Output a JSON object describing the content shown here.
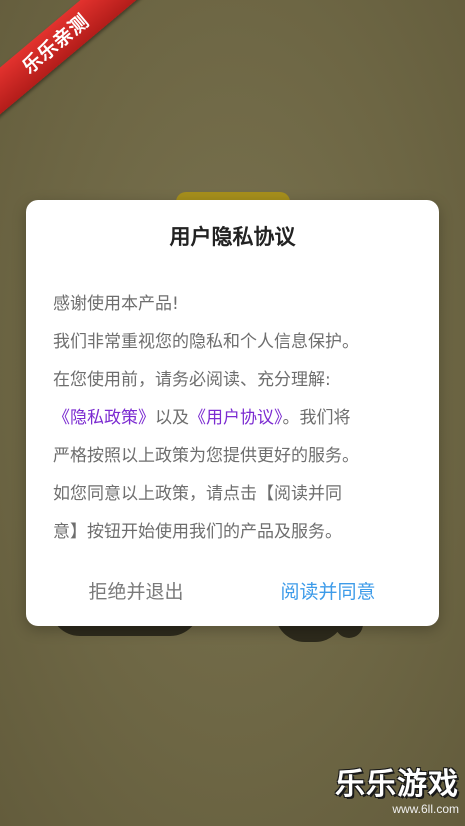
{
  "ribbon": {
    "text": "乐乐亲测"
  },
  "dialog": {
    "title": "用户隐私协议",
    "lines": {
      "line1": "感谢使用本产品!",
      "line2": "我们非常重视您的隐私和个人信息保护。",
      "line3": "在您使用前，请务必阅读、充分理解:",
      "line4_privacy_link": "《隐私政策》",
      "line4_mid": "以及",
      "line4_agreement_link": "《用户协议》",
      "line4_end": "。我们将",
      "line5": "严格按照以上政策为您提供更好的服务。",
      "line6": "如您同意以上政策，请点击【阅读并同",
      "line7": "意】按钮开始使用我们的产品及服务。"
    },
    "buttons": {
      "reject": "拒绝并退出",
      "accept": "阅读并同意"
    },
    "colors": {
      "link": "#7b2bd1",
      "accept": "#3d9be9",
      "reject": "#7a7a7a"
    }
  },
  "watermark": {
    "logo": "乐乐游戏",
    "url": "www.6ll.com"
  }
}
